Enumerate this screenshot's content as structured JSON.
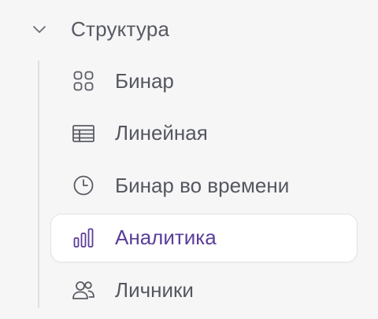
{
  "section": {
    "title": "Структура",
    "expanded": true,
    "chevron_icon": "chevron-down-icon"
  },
  "nav": {
    "active_index": 3,
    "items": [
      {
        "label": "Бинар",
        "icon": "grid-icon"
      },
      {
        "label": "Линейная",
        "icon": "table-icon"
      },
      {
        "label": "Бинар во времени",
        "icon": "clock-icon"
      },
      {
        "label": "Аналитика",
        "icon": "bar-chart-icon"
      },
      {
        "label": "Личники",
        "icon": "users-icon"
      }
    ]
  },
  "colors": {
    "background": "#f6f6f7",
    "text": "#55575f",
    "accent": "#5b3d9a",
    "active_bg": "#ffffff",
    "active_border": "#e3e3e7",
    "tree_line": "#dedfe3"
  }
}
